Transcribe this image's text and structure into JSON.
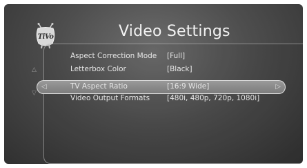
{
  "header": {
    "logo_text": "TiVo",
    "title": "Video Settings"
  },
  "settings": [
    {
      "label": "Aspect Correction Mode",
      "value": "[Full]"
    },
    {
      "label": "Letterbox Color",
      "value": "[Black]"
    },
    {
      "label": "TV Aspect Ratio",
      "value": "[16:9 Wide]"
    },
    {
      "label": "Video Output Formats",
      "value": "[480i, 480p, 720p, 1080i]"
    }
  ],
  "selected_index": 2,
  "icons": {
    "up": "up-arrow-icon",
    "down": "down-arrow-icon",
    "left": "left-arrow-icon",
    "right": "right-arrow-icon"
  },
  "colors": {
    "background": "#4e4e4e",
    "text": "#e6e6e6",
    "title": "#f2f2f2",
    "highlight": "#8a8a8a"
  }
}
